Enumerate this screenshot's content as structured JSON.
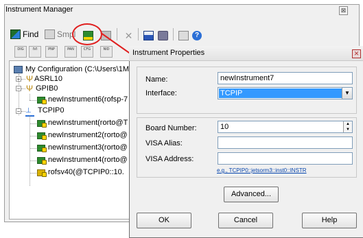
{
  "window": {
    "title": "Instrument Manager",
    "close_glyph": "⊠"
  },
  "toolbar": {
    "find_label": "Find",
    "smpl_label": "Smpl",
    "items": [
      "find",
      "smpl",
      "new-instrument",
      "properties",
      "delete",
      "save",
      "print",
      "help-connect",
      "help"
    ]
  },
  "toolbar2": {
    "buttons": [
      "DIG",
      "IVI",
      "PNP",
      "PAN",
      "CFG",
      "NID"
    ]
  },
  "tree": {
    "root": "My Configuration (C:\\Users\\1M",
    "asrl": "ASRL10",
    "gpib": "GPIB0",
    "gpib_child": "newInstrument6(rofsp-7",
    "tcpip": "TCPIP0",
    "tcpip_children": [
      "newInstrument(rorto@T",
      "newInstrument2(rorto@",
      "newInstrument3(rorto@",
      "newInstrument4(rorto@",
      "rofsv40(@TCPIP0::10."
    ]
  },
  "dialog": {
    "title": "Instrument Properties",
    "close_glyph": "✕",
    "name_label": "Name:",
    "name_value": "newInstrument7",
    "interface_label": "Interface:",
    "interface_value": "TCPIP",
    "board_label": "Board Number:",
    "board_value": "10",
    "visa_alias_label": "VISA Alias:",
    "visa_alias_value": "",
    "visa_address_label": "VISA Address:",
    "visa_address_value": "",
    "example_link": "e.g., TCPIP0::jetsorm3::inst0::INSTR",
    "advanced_label": "Advanced...",
    "ok_label": "OK",
    "cancel_label": "Cancel",
    "help_label": "Help"
  },
  "colors": {
    "selection": "#3399ff",
    "annotation": "#e02020",
    "link": "#0645ad"
  }
}
